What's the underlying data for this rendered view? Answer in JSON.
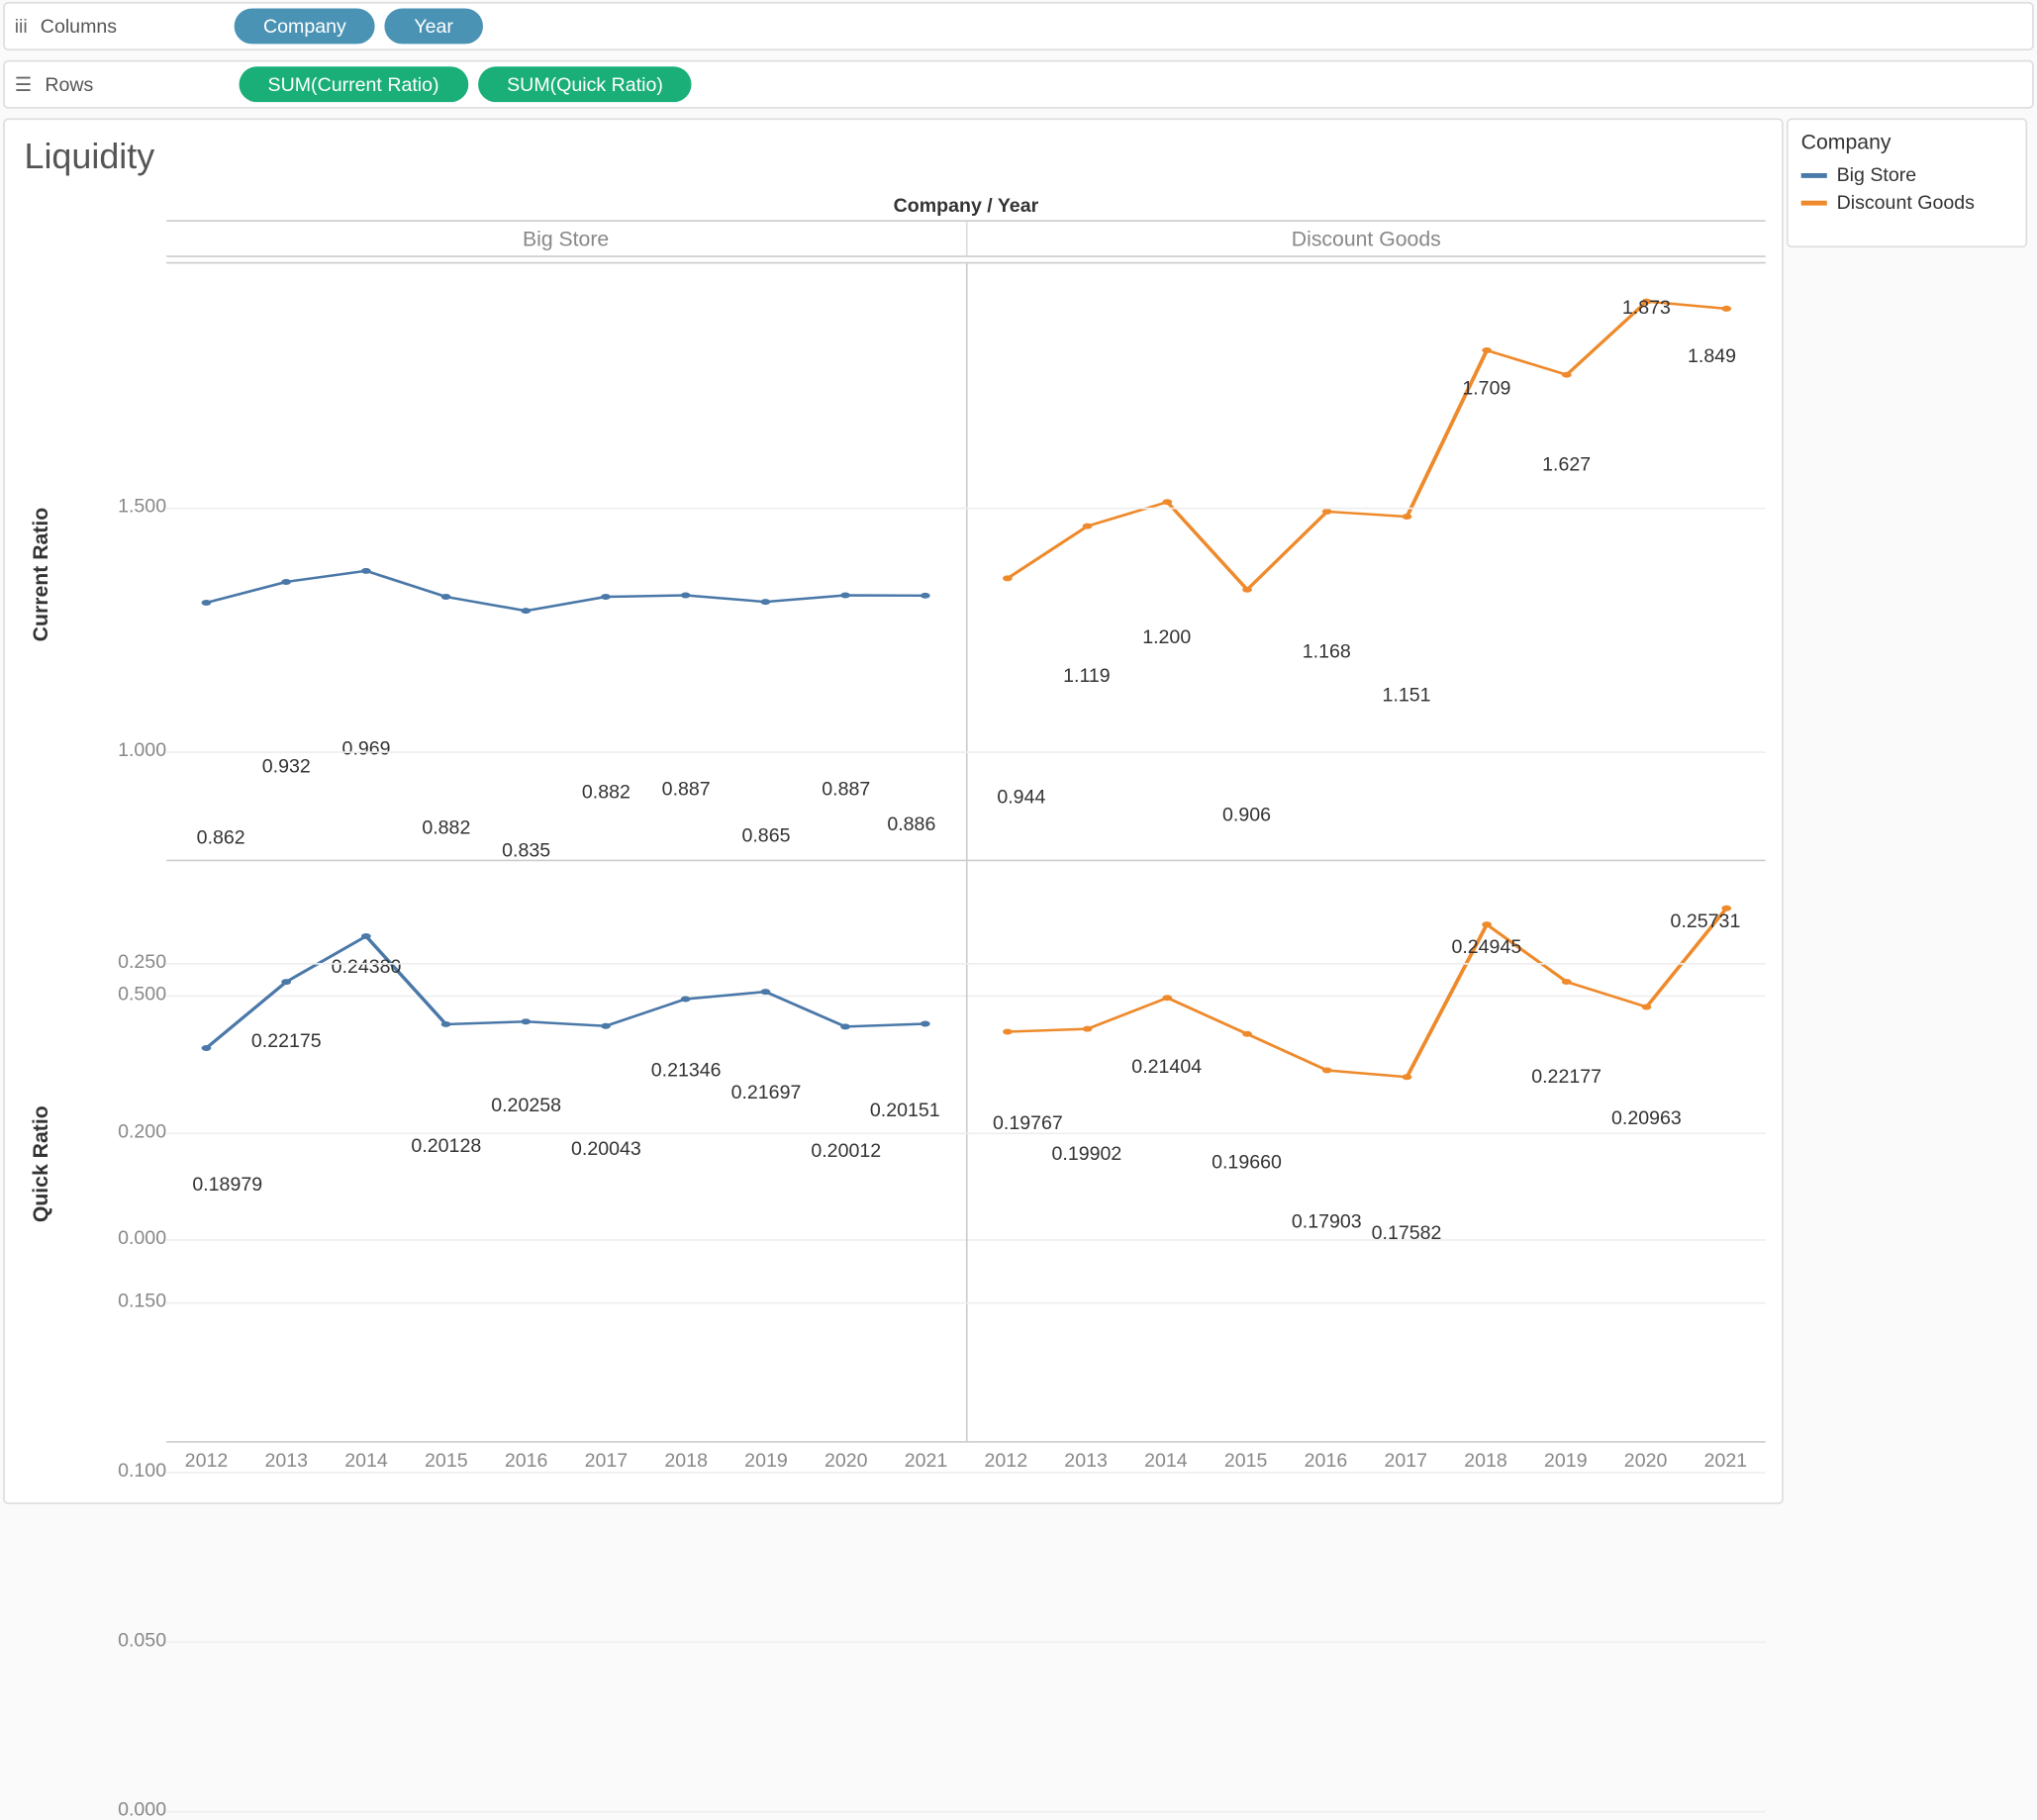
{
  "shelves": {
    "columns_label": "Columns",
    "rows_label": "Rows",
    "column_pills": [
      "Company",
      "Year"
    ],
    "row_pills": [
      "SUM(Current Ratio)",
      "SUM(Quick Ratio)"
    ]
  },
  "title": "Liquidity",
  "legend": {
    "title": "Company",
    "items": [
      {
        "label": "Big Store",
        "color": "#4a78a8"
      },
      {
        "label": "Discount Goods",
        "color": "#ee8a2b"
      }
    ]
  },
  "super_header": "Company / Year",
  "companies": [
    "Big Store",
    "Discount Goods"
  ],
  "years": [
    "2012",
    "2013",
    "2014",
    "2015",
    "2016",
    "2017",
    "2018",
    "2019",
    "2020",
    "2021"
  ],
  "chart_data": [
    {
      "type": "line",
      "measure": "Current Ratio",
      "ylim": [
        0,
        2.0
      ],
      "yticks": [
        0.0,
        0.5,
        1.0,
        1.5
      ],
      "series": [
        {
          "name": "Big Store",
          "color": "#4a78a8",
          "x": [
            "2012",
            "2013",
            "2014",
            "2015",
            "2016",
            "2017",
            "2018",
            "2019",
            "2020",
            "2021"
          ],
          "values": [
            0.862,
            0.932,
            0.969,
            0.882,
            0.835,
            0.882,
            0.887,
            0.865,
            0.887,
            0.886
          ],
          "label_pos": [
            "b",
            "t",
            "t",
            "b",
            "b",
            "t",
            "t",
            "b",
            "t",
            "b"
          ]
        },
        {
          "name": "Discount Goods",
          "color": "#ee8a2b",
          "x": [
            "2012",
            "2013",
            "2014",
            "2015",
            "2016",
            "2017",
            "2018",
            "2019",
            "2020",
            "2021"
          ],
          "values": [
            0.944,
            1.119,
            1.2,
            0.906,
            1.168,
            1.151,
            1.709,
            1.627,
            1.873,
            1.849
          ],
          "label_pos": [
            "b",
            "t",
            "t",
            "b",
            "t",
            "b",
            "t",
            "b",
            "t",
            "b"
          ]
        }
      ]
    },
    {
      "type": "line",
      "measure": "Quick Ratio",
      "ylim": [
        0,
        0.28
      ],
      "yticks": [
        0.0,
        0.05,
        0.1,
        0.15,
        0.2,
        0.25
      ],
      "series": [
        {
          "name": "Big Store",
          "color": "#4a78a8",
          "x": [
            "2012",
            "2013",
            "2014",
            "2015",
            "2016",
            "2017",
            "2018",
            "2019",
            "2020",
            "2021"
          ],
          "values": [
            0.18979,
            0.22175,
            0.2438,
            0.20128,
            0.20258,
            0.20043,
            0.21346,
            0.21697,
            0.20012,
            0.20151
          ],
          "label_pos": [
            "b",
            "t",
            "t",
            "b",
            "t",
            "b",
            "t",
            "b",
            "b",
            "t"
          ]
        },
        {
          "name": "Discount Goods",
          "color": "#ee8a2b",
          "x": [
            "2012",
            "2013",
            "2014",
            "2015",
            "2016",
            "2017",
            "2018",
            "2019",
            "2020",
            "2021"
          ],
          "values": [
            0.19767,
            0.19902,
            0.21404,
            0.1966,
            0.17903,
            0.17582,
            0.24945,
            0.22177,
            0.20963,
            0.25731
          ],
          "label_pos": [
            "t",
            "b",
            "t",
            "b",
            "b",
            "b",
            "t",
            "b",
            "b",
            "t"
          ]
        }
      ]
    }
  ]
}
